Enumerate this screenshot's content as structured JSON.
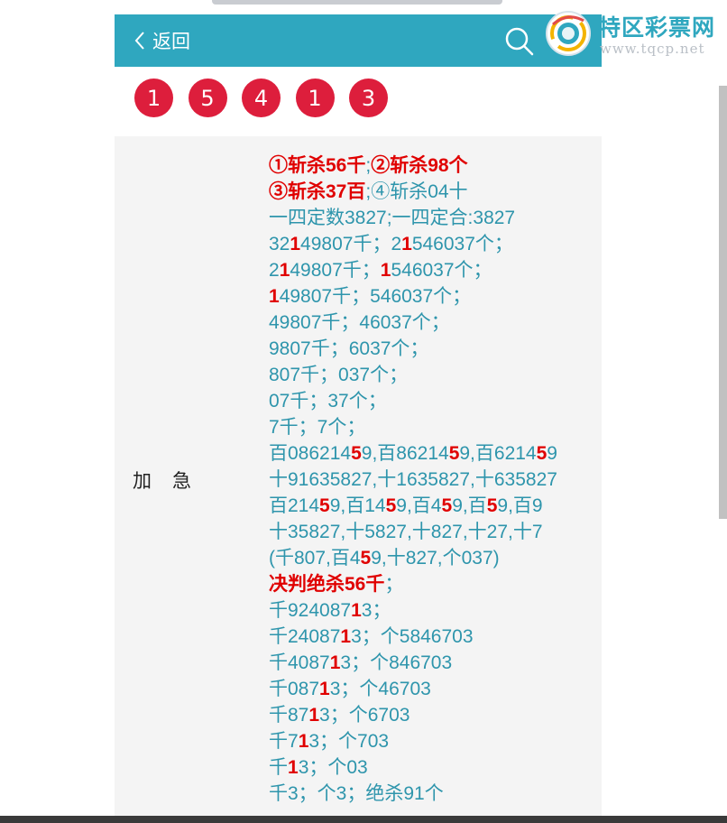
{
  "nav": {
    "back_label": "返回"
  },
  "site": {
    "title": "特区彩票网",
    "url": "www.tqcp.net"
  },
  "balls": [
    "1",
    "5",
    "4",
    "1",
    "3"
  ],
  "section": {
    "label": "加　急"
  },
  "lines": [
    [
      {
        "t": "①斩杀56千",
        "r": 1
      },
      {
        "t": ";"
      },
      {
        "t": "②斩杀98个",
        "r": 1
      }
    ],
    [
      {
        "t": "③斩杀37百",
        "r": 1
      },
      {
        "t": ";④斩杀04十"
      }
    ],
    [
      {
        "t": "一四定数3827;一四定合:3827"
      }
    ],
    [
      {
        "t": "32"
      },
      {
        "t": "1",
        "r": 1
      },
      {
        "t": "49807千；2"
      },
      {
        "t": "1",
        "r": 1
      },
      {
        "t": "546037个；"
      }
    ],
    [
      {
        "t": "2"
      },
      {
        "t": "1",
        "r": 1
      },
      {
        "t": "49807千；"
      },
      {
        "t": "1",
        "r": 1
      },
      {
        "t": "546037个；"
      }
    ],
    [
      {
        "t": "1",
        "r": 1
      },
      {
        "t": "49807千；546037个；"
      }
    ],
    [
      {
        "t": "49807千；46037个；"
      }
    ],
    [
      {
        "t": "9807千；6037个；"
      }
    ],
    [
      {
        "t": "807千；037个；"
      }
    ],
    [
      {
        "t": "07千；37个；"
      }
    ],
    [
      {
        "t": "7千；7个；"
      }
    ],
    [
      {
        "t": "百086214"
      },
      {
        "t": "5",
        "r": 1
      },
      {
        "t": "9,百86214"
      },
      {
        "t": "5",
        "r": 1
      },
      {
        "t": "9,百6214"
      },
      {
        "t": "5",
        "r": 1
      },
      {
        "t": "9"
      }
    ],
    [
      {
        "t": "十91635827,十1635827,十635827"
      }
    ],
    [
      {
        "t": "百214"
      },
      {
        "t": "5",
        "r": 1
      },
      {
        "t": "9,百14"
      },
      {
        "t": "5",
        "r": 1
      },
      {
        "t": "9,百4"
      },
      {
        "t": "5",
        "r": 1
      },
      {
        "t": "9,百"
      },
      {
        "t": "5",
        "r": 1
      },
      {
        "t": "9,百9"
      }
    ],
    [
      {
        "t": "十35827,十5827,十827,十27,十7"
      }
    ],
    [
      {
        "t": "(千807,百4"
      },
      {
        "t": "5",
        "r": 1
      },
      {
        "t": "9,十827,个037)"
      }
    ],
    [
      {
        "t": "决判绝杀56千",
        "r": 1
      },
      {
        "t": "；"
      }
    ],
    [
      {
        "t": "千924087"
      },
      {
        "t": "1",
        "r": 1
      },
      {
        "t": "3；"
      }
    ],
    [
      {
        "t": "千24087"
      },
      {
        "t": "1",
        "r": 1
      },
      {
        "t": "3；个5846703"
      }
    ],
    [
      {
        "t": "千4087"
      },
      {
        "t": "1",
        "r": 1
      },
      {
        "t": "3；个846703"
      }
    ],
    [
      {
        "t": "千087"
      },
      {
        "t": "1",
        "r": 1
      },
      {
        "t": "3；个46703"
      }
    ],
    [
      {
        "t": "千87"
      },
      {
        "t": "1",
        "r": 1
      },
      {
        "t": "3；个6703"
      }
    ],
    [
      {
        "t": "千7"
      },
      {
        "t": "1",
        "r": 1
      },
      {
        "t": "3；个703"
      }
    ],
    [
      {
        "t": "千"
      },
      {
        "t": "1",
        "r": 1
      },
      {
        "t": "3；个03"
      }
    ],
    [
      {
        "t": "千3；个3；绝杀91个"
      }
    ]
  ],
  "colors": {
    "header": "#2fa7bf",
    "ball": "#dd1e3c",
    "text": "#2e95ac",
    "highlight": "#e00000"
  }
}
